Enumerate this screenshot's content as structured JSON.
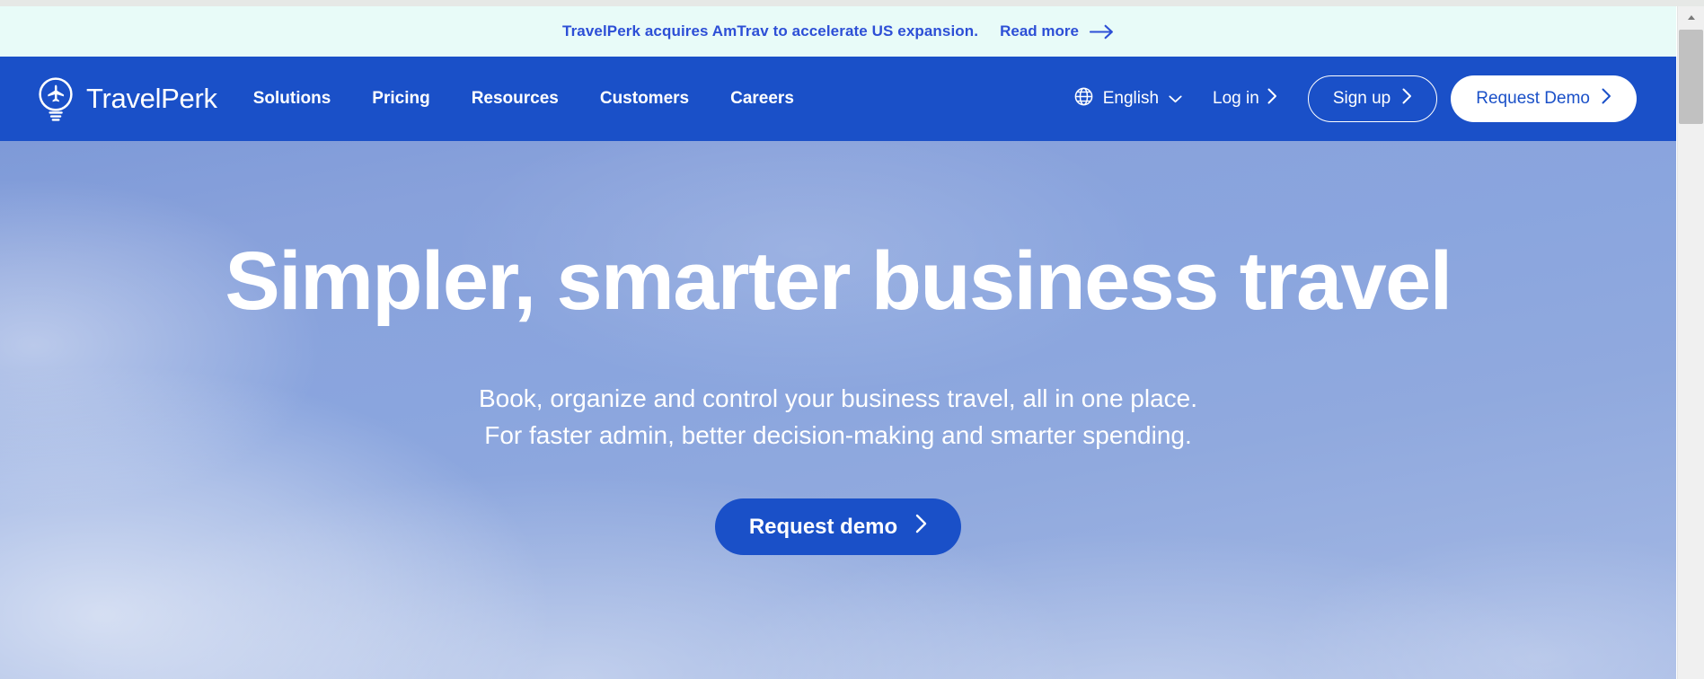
{
  "announcement": {
    "text": "TravelPerk acquires AmTrav to accelerate US expansion.",
    "link_label": "Read more",
    "arrow_icon": "arrow-right-icon",
    "background_color": "#e8fbf8",
    "text_color": "#2d4fd6"
  },
  "navbar": {
    "background_color": "#1a50c8",
    "brand": {
      "name": "TravelPerk",
      "logo_icon": "travelperk-airplane-lightbulb-logo-icon"
    },
    "links": [
      {
        "label": "Solutions"
      },
      {
        "label": "Pricing"
      },
      {
        "label": "Resources"
      },
      {
        "label": "Customers"
      },
      {
        "label": "Careers"
      }
    ],
    "language": {
      "globe_icon": "globe-icon",
      "value": "English",
      "chevron_icon": "chevron-down-icon"
    },
    "login": {
      "label": "Log in",
      "chevron_icon": "chevron-right-icon"
    },
    "signup": {
      "label": "Sign up",
      "chevron_icon": "chevron-right-icon"
    },
    "demo": {
      "label": "Request Demo",
      "chevron_icon": "chevron-right-icon"
    }
  },
  "hero": {
    "title": "Simpler, smarter business travel",
    "subtitle_line1": "Book, organize and control your business travel, all in one place.",
    "subtitle_line2": "For faster admin, better decision-making and smarter spending.",
    "cta": {
      "label": "Request demo",
      "chevron_icon": "chevron-right-icon",
      "background_color": "#1a50c8"
    }
  },
  "browser": {
    "scrollbar": {
      "up_arrow_icon": "scroll-up-arrow-icon"
    }
  }
}
